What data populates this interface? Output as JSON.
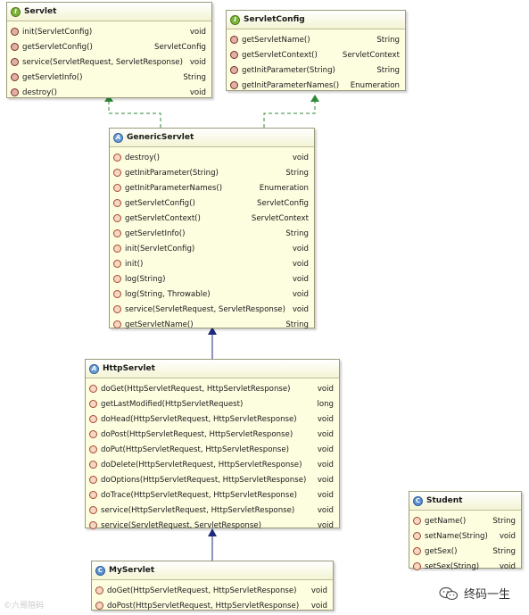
{
  "classes": {
    "servlet": {
      "name": "Servlet",
      "icon": "interface-icon",
      "badge": "I",
      "methods": [
        {
          "sig": "init(ServletConfig)",
          "ret": "void"
        },
        {
          "sig": "getServletConfig()",
          "ret": "ServletConfig"
        },
        {
          "sig": "service(ServletRequest, ServletResponse)",
          "ret": "void"
        },
        {
          "sig": "getServletInfo()",
          "ret": "String"
        },
        {
          "sig": "destroy()",
          "ret": "void"
        }
      ]
    },
    "servletconfig": {
      "name": "ServletConfig",
      "icon": "interface-icon",
      "badge": "I",
      "methods": [
        {
          "sig": "getServletName()",
          "ret": "String"
        },
        {
          "sig": "getServletContext()",
          "ret": "ServletContext"
        },
        {
          "sig": "getInitParameter(String)",
          "ret": "String"
        },
        {
          "sig": "getInitParameterNames()",
          "ret": "Enumeration"
        }
      ]
    },
    "genericservlet": {
      "name": "GenericServlet",
      "icon": "abstract-class-icon",
      "badge": "A",
      "methods": [
        {
          "sig": "destroy()",
          "ret": "void"
        },
        {
          "sig": "getInitParameter(String)",
          "ret": "String"
        },
        {
          "sig": "getInitParameterNames()",
          "ret": "Enumeration"
        },
        {
          "sig": "getServletConfig()",
          "ret": "ServletConfig"
        },
        {
          "sig": "getServletContext()",
          "ret": "ServletContext"
        },
        {
          "sig": "getServletInfo()",
          "ret": "String"
        },
        {
          "sig": "init(ServletConfig)",
          "ret": "void"
        },
        {
          "sig": "init()",
          "ret": "void"
        },
        {
          "sig": "log(String)",
          "ret": "void"
        },
        {
          "sig": "log(String, Throwable)",
          "ret": "void"
        },
        {
          "sig": "service(ServletRequest, ServletResponse)",
          "ret": "void"
        },
        {
          "sig": "getServletName()",
          "ret": "String"
        }
      ]
    },
    "httpservlet": {
      "name": "HttpServlet",
      "icon": "abstract-class-icon",
      "badge": "A",
      "methods": [
        {
          "sig": "doGet(HttpServletRequest, HttpServletResponse)",
          "ret": "void"
        },
        {
          "sig": "getLastModified(HttpServletRequest)",
          "ret": "long"
        },
        {
          "sig": "doHead(HttpServletRequest, HttpServletResponse)",
          "ret": "void"
        },
        {
          "sig": "doPost(HttpServletRequest, HttpServletResponse)",
          "ret": "void"
        },
        {
          "sig": "doPut(HttpServletRequest, HttpServletResponse)",
          "ret": "void"
        },
        {
          "sig": "doDelete(HttpServletRequest, HttpServletResponse)",
          "ret": "void"
        },
        {
          "sig": "doOptions(HttpServletRequest, HttpServletResponse)",
          "ret": "void"
        },
        {
          "sig": "doTrace(HttpServletRequest, HttpServletResponse)",
          "ret": "void"
        },
        {
          "sig": "service(HttpServletRequest, HttpServletResponse)",
          "ret": "void"
        },
        {
          "sig": "service(ServletRequest, ServletResponse)",
          "ret": "void"
        }
      ]
    },
    "myservlet": {
      "name": "MyServlet",
      "icon": "class-icon",
      "badge": "C",
      "methods": [
        {
          "sig": "doGet(HttpServletRequest, HttpServletResponse)",
          "ret": "void"
        },
        {
          "sig": "doPost(HttpServletRequest, HttpServletResponse)",
          "ret": "void"
        }
      ]
    },
    "student": {
      "name": "Student",
      "icon": "class-icon",
      "badge": "C",
      "methods": [
        {
          "sig": "getName()",
          "ret": "String"
        },
        {
          "sig": "setName(String)",
          "ret": "void"
        },
        {
          "sig": "getSex()",
          "ret": "String"
        },
        {
          "sig": "setSex(String)",
          "ret": "void"
        }
      ]
    }
  },
  "watermark": {
    "text": "©六哥陪码"
  },
  "brand": {
    "text": "终码一生",
    "icon": "wechat-icon"
  },
  "colors": {
    "box_fill": "#fdfde0",
    "realization_arrow": "#2e8b3a",
    "generalization_arrow": "#1e2a7a"
  }
}
